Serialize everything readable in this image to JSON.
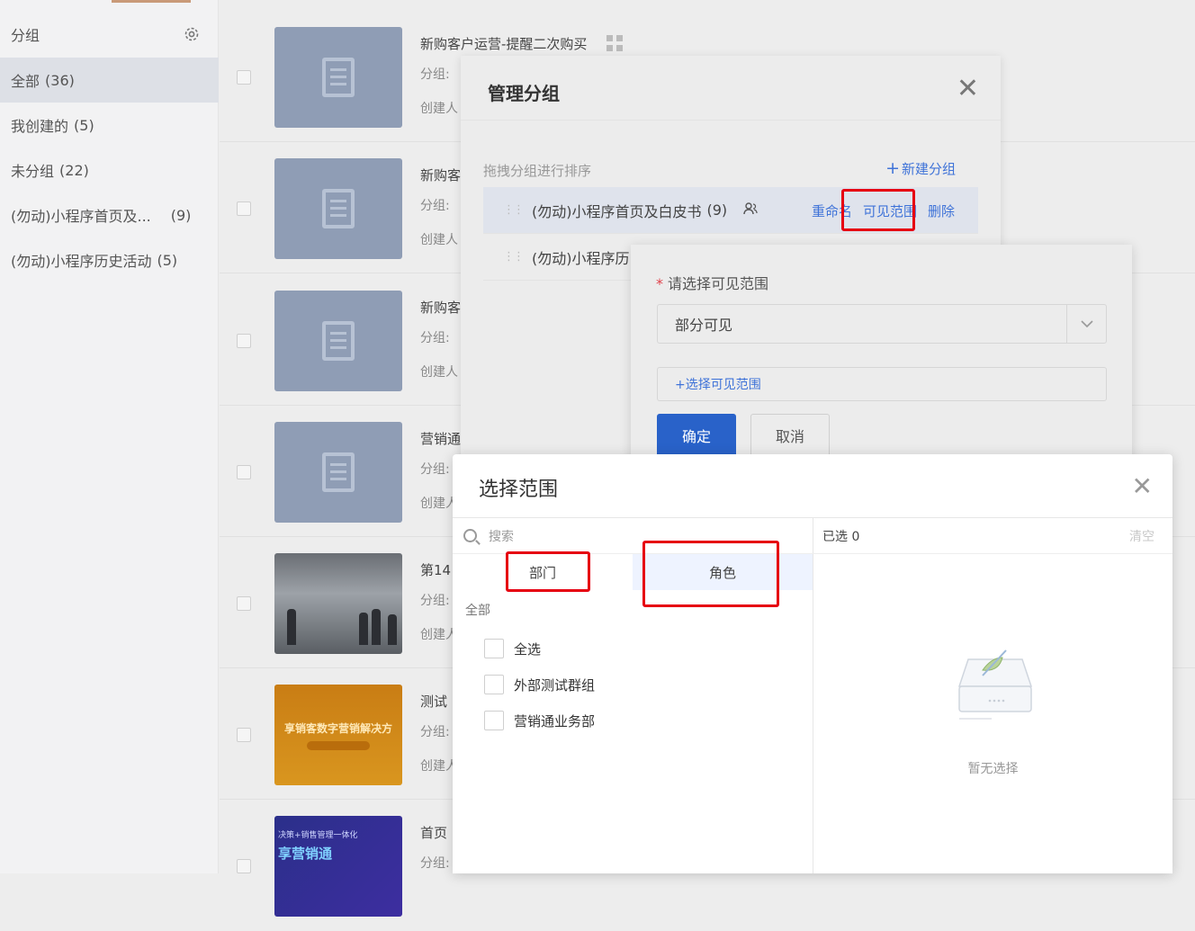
{
  "sidebar": {
    "header": "分组",
    "items": [
      {
        "label": "全部",
        "count": "(36)"
      },
      {
        "label": "我创建的",
        "count": "(5)"
      },
      {
        "label": "未分组",
        "count": "(22)"
      },
      {
        "label": "(勿动)小程序首页及...",
        "count": "(9)"
      },
      {
        "label": "(勿动)小程序历史活动",
        "count": "(5)"
      }
    ]
  },
  "list": {
    "rows": [
      {
        "title": "新购客户运营-提醒二次购买",
        "meta1": "分组:",
        "meta2": "创建人"
      },
      {
        "title": "新购客",
        "meta1": "分组:",
        "meta2": "创建人"
      },
      {
        "title": "新购客",
        "meta1": "分组:",
        "meta2": "创建人"
      },
      {
        "title": "营销通",
        "meta1": "分组:",
        "meta2": "创建人"
      },
      {
        "title": "第14",
        "meta1": "分组:",
        "meta2": "创建人"
      },
      {
        "title": "测试",
        "meta1": "分组:",
        "meta2": "创建人"
      },
      {
        "title": "首页",
        "meta1": "分组:",
        "meta2": ""
      }
    ],
    "thumb_orange_text": "享销客数字营销解决方",
    "thumb_navy_small": "决策+销售管理一体化",
    "thumb_navy_big": "享营销通"
  },
  "manage_dialog": {
    "title": "管理分组",
    "hint": "拖拽分组进行排序",
    "new_group": "新建分组",
    "groups": [
      {
        "name": "(勿动)小程序首页及白皮书",
        "count": "(9)"
      },
      {
        "name": "(勿动)小程序历",
        "count": ""
      }
    ],
    "actions": {
      "rename": "重命名",
      "visibility": "可见范围",
      "delete": "删除"
    }
  },
  "visibility_popover": {
    "label": "请选择可见范围",
    "required_mark": "*",
    "selected": "部分可见",
    "pick_label": "+选择可见范围",
    "confirm": "确定",
    "cancel": "取消"
  },
  "scope_dialog": {
    "title": "选择范围",
    "search_placeholder": "搜索",
    "tabs": [
      "部门",
      "角色"
    ],
    "all_label": "全部",
    "options": [
      "全选",
      "外部测试群组",
      "营销通业务部"
    ],
    "selected_count": "已选 0",
    "clear": "清空",
    "empty": "暂无选择"
  },
  "colors": {
    "accent": "#3f73d8",
    "primary_button": "#2962c9",
    "highlight": "#e60012",
    "required": "#e0414a"
  }
}
